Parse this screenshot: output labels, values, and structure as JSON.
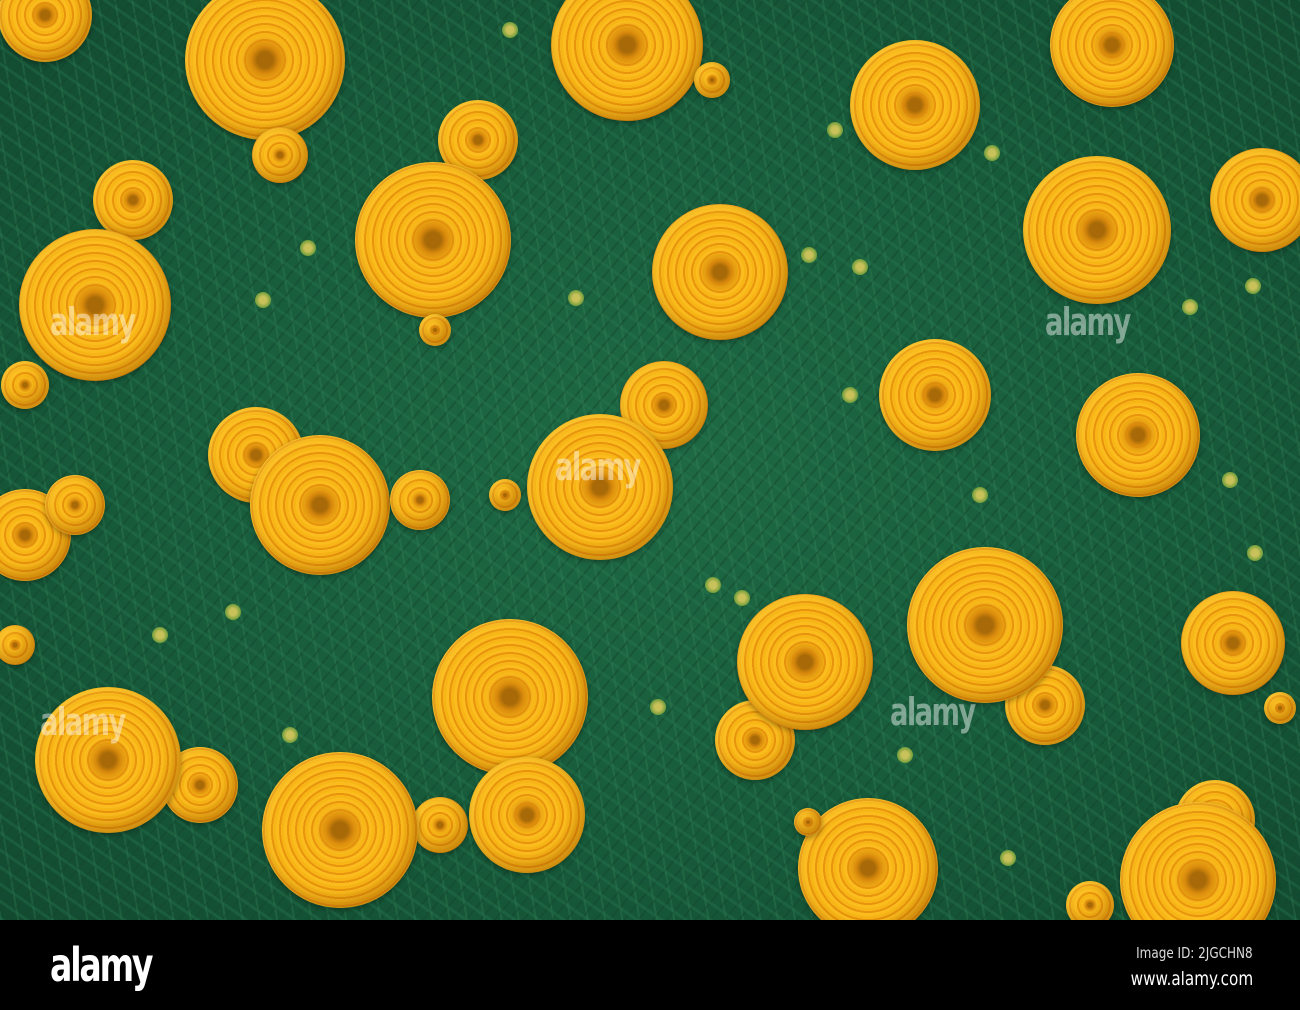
{
  "photo": {
    "subject": "marigold flowers",
    "colors": {
      "foliage": "#1a5e3c",
      "petals": "#f4aa14",
      "center": "#a86a08"
    },
    "watermark": "alamy"
  },
  "footer": {
    "logo": "alamy",
    "image_id": "Image ID: 2JGCHN8",
    "url": "www.alamy.com"
  }
}
